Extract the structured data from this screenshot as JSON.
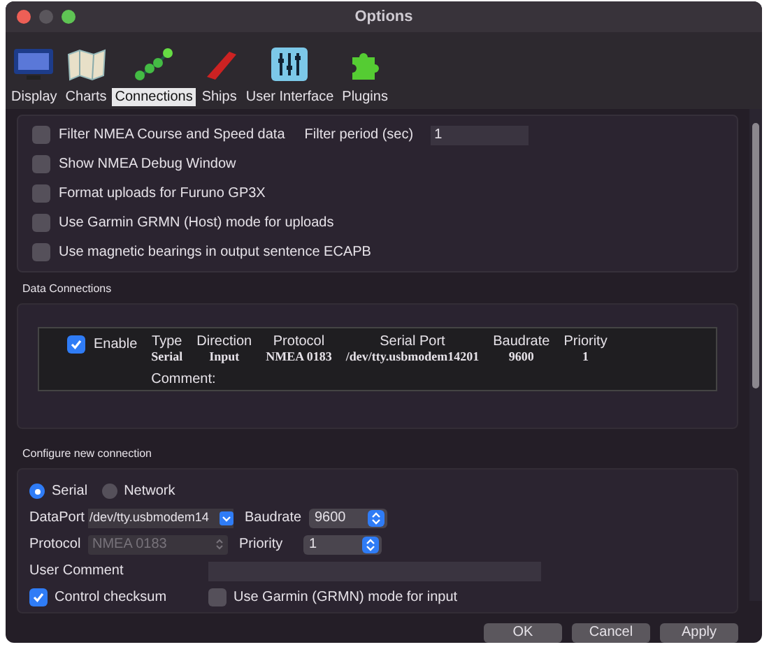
{
  "window": {
    "title": "Options"
  },
  "tabs": [
    {
      "label": "Display",
      "selected": false
    },
    {
      "label": "Charts",
      "selected": false
    },
    {
      "label": "Connections",
      "selected": true
    },
    {
      "label": "Ships",
      "selected": false
    },
    {
      "label": "User Interface",
      "selected": false
    },
    {
      "label": "Plugins",
      "selected": false
    }
  ],
  "general": {
    "filter": {
      "label": "Filter NMEA Course and Speed data",
      "checked": false,
      "period_label": "Filter period (sec)",
      "period_value": "1"
    },
    "options": [
      {
        "label": "Show NMEA Debug Window",
        "checked": false
      },
      {
        "label": "Format uploads for Furuno GP3X",
        "checked": false
      },
      {
        "label": "Use Garmin GRMN (Host) mode for uploads",
        "checked": false
      },
      {
        "label": "Use magnetic bearings in output sentence ECAPB",
        "checked": false
      }
    ]
  },
  "data_connections": {
    "title": "Data Connections",
    "connections": [
      {
        "enabled": true,
        "enable_label": "Enable",
        "comment_label": "Comment:",
        "columns": [
          {
            "header": "Type",
            "value": "Serial"
          },
          {
            "header": "Direction",
            "value": "Input"
          },
          {
            "header": "Protocol",
            "value": "NMEA 0183"
          },
          {
            "header": "Serial Port",
            "value": "/dev/tty.usbmodem14201"
          },
          {
            "header": "Baudrate",
            "value": "9600"
          },
          {
            "header": "Priority",
            "value": "1"
          }
        ]
      }
    ]
  },
  "configure": {
    "title": "Configure new connection",
    "types": [
      {
        "label": "Serial",
        "selected": true
      },
      {
        "label": "Network",
        "selected": false
      }
    ],
    "dataport": {
      "label": "DataPort",
      "value": "/dev/tty.usbmodem14"
    },
    "baudrate": {
      "label": "Baudrate",
      "value": "9600"
    },
    "protocol": {
      "label": "Protocol",
      "value": "NMEA 0183",
      "disabled": true
    },
    "priority": {
      "label": "Priority",
      "value": "1"
    },
    "user_comment": {
      "label": "User Comment"
    },
    "control_checksum": {
      "label": "Control checksum",
      "checked": true
    },
    "garmin_input": {
      "label": "Use Garmin (GRMN) mode for input",
      "checked": false
    }
  },
  "buttons": [
    {
      "label": "OK"
    },
    {
      "label": "Cancel"
    },
    {
      "label": "Apply"
    }
  ]
}
